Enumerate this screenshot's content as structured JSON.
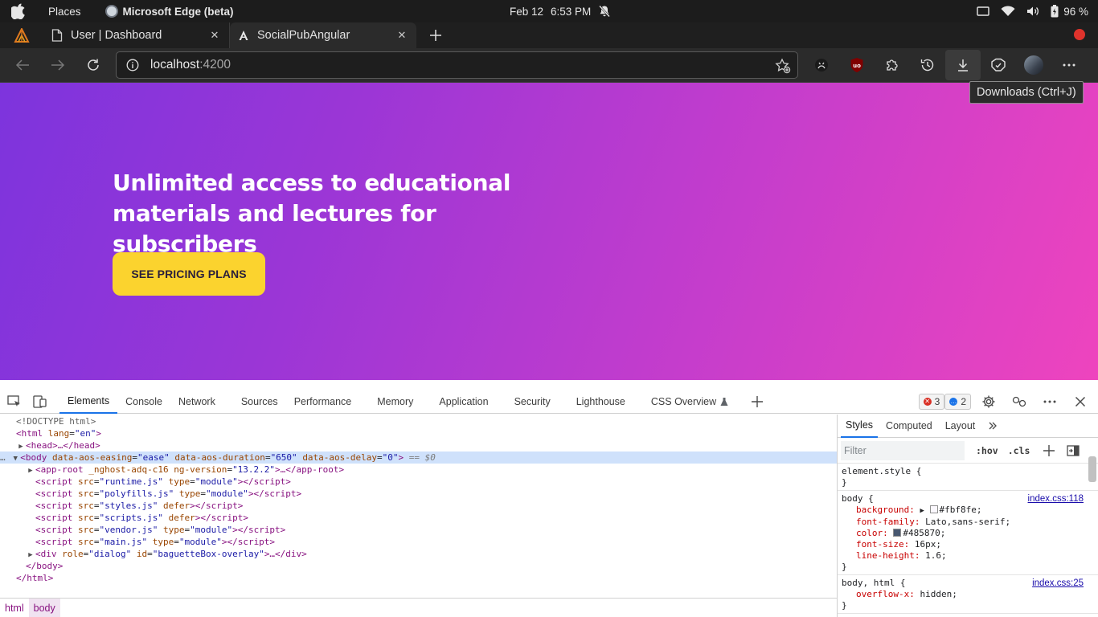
{
  "system_bar": {
    "places": "Places",
    "app_name": "Microsoft Edge (beta)",
    "date": "Feb 12",
    "time": "6:53 PM",
    "battery": "96 %"
  },
  "tabs": [
    {
      "title": "User | Dashboard",
      "active": false
    },
    {
      "title": "SocialPubAngular",
      "active": true
    }
  ],
  "address_bar": {
    "host": "localhost",
    "port": ":4200"
  },
  "tooltip": "Downloads (Ctrl+J)",
  "hero": {
    "title_line1": "Unlimited access to educational",
    "title_line2": "materials and lectures for subscribers",
    "button_label": "SEE PRICING PLANS"
  },
  "devtools": {
    "tabs": [
      "Elements",
      "Console",
      "Network",
      "Sources",
      "Performance",
      "Memory",
      "Application",
      "Security",
      "Lighthouse",
      "CSS Overview"
    ],
    "active_tab": "Elements",
    "error_count": "3",
    "message_count": "2",
    "dom": {
      "doctype": "<!DOCTYPE html>",
      "html_open_tag": "<html",
      "html_lang_attr": "lang",
      "html_lang_val": "\"en\"",
      "head": "<head>…</head>",
      "body_open": "<body",
      "body_a1": "data-aos-easing",
      "body_v1": "\"ease\"",
      "body_a2": "data-aos-duration",
      "body_v2": "\"650\"",
      "body_a3": "data-aos-delay",
      "body_v3": "\"0\"",
      "body_marker": "== $0",
      "approot_tag": "<app-root",
      "approot_a1": "_nghost-adq-c16",
      "approot_a2": "ng-version",
      "approot_v2": "\"13.2.2\"",
      "approot_close": ">…</app-root>",
      "scripts": [
        {
          "src": "\"runtime.js\"",
          "extra_attr": "type",
          "extra_val": "\"module\""
        },
        {
          "src": "\"polyfills.js\"",
          "extra_attr": "type",
          "extra_val": "\"module\""
        },
        {
          "src": "\"styles.js\"",
          "extra_attr": "defer",
          "extra_val": ""
        },
        {
          "src": "\"scripts.js\"",
          "extra_attr": "defer",
          "extra_val": ""
        },
        {
          "src": "\"vendor.js\"",
          "extra_attr": "type",
          "extra_val": "\"module\""
        },
        {
          "src": "\"main.js\"",
          "extra_attr": "type",
          "extra_val": "\"module\""
        }
      ],
      "div_tag": "<div",
      "div_a1": "role",
      "div_v1": "\"dialog\"",
      "div_a2": "id",
      "div_v2": "\"baguetteBox-overlay\"",
      "div_close": ">…</div>",
      "body_close": "</body>",
      "html_close": "</html>"
    },
    "breadcrumbs": [
      "html",
      "body"
    ],
    "styles_tabs": [
      "Styles",
      "Computed",
      "Layout"
    ],
    "filter_placeholder": "Filter",
    "hov": ":hov",
    "cls": ".cls",
    "rules": {
      "element_style": "element.style {",
      "body_selector": "body {",
      "body_source": "index.css:118",
      "background_name": "background:",
      "background_val": "#fbf8fe;",
      "font_family_name": "font-family:",
      "font_family_val": "Lato,sans-serif;",
      "color_name": "color:",
      "color_val": "#485870;",
      "font_size_name": "font-size:",
      "font_size_val": "16px;",
      "line_height_name": "line-height:",
      "line_height_val": "1.6;",
      "bodyhtml_selector": "body, html {",
      "bodyhtml_source": "index.css:25",
      "overflow_name": "overflow-x:",
      "overflow_val": "hidden;",
      "close_brace": "}"
    },
    "colors": {
      "swatch_bg": "#fbf8fe",
      "swatch_color": "#485870"
    }
  }
}
